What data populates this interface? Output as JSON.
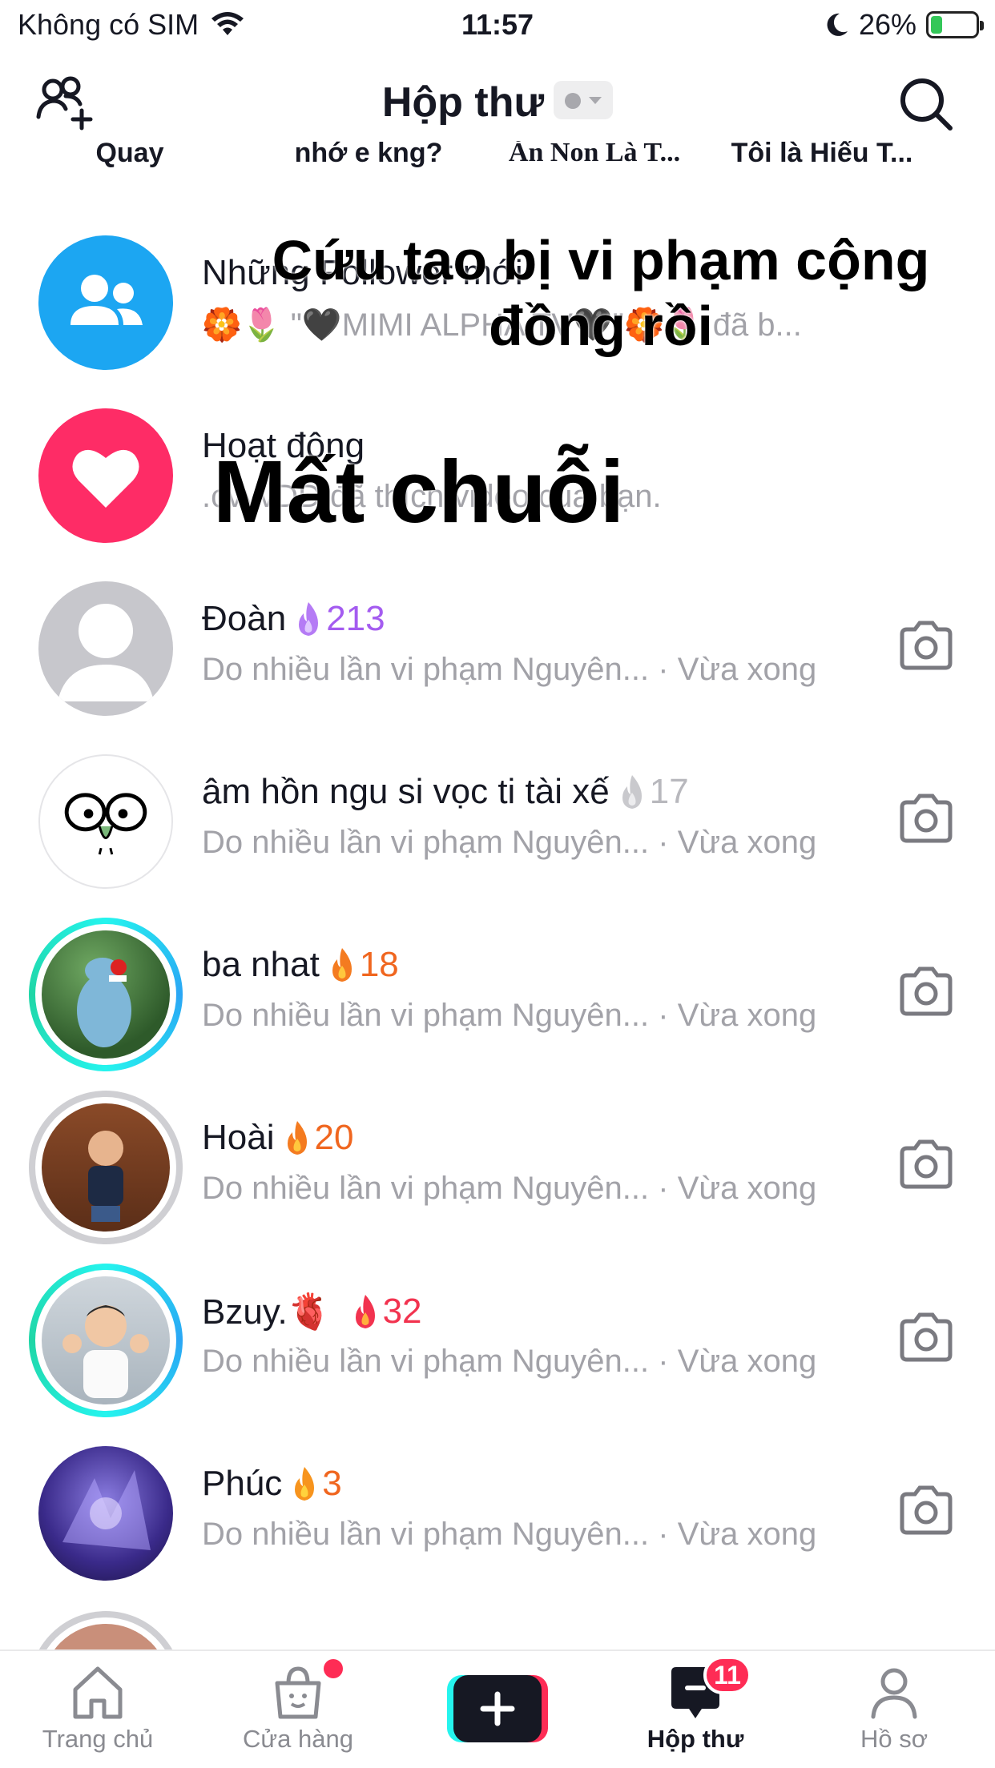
{
  "status_bar": {
    "carrier": "Không có SIM",
    "time": "11:57",
    "battery_percent": "26%",
    "battery_level": 0.26
  },
  "header": {
    "title": "Hộp thư",
    "icons": [
      "add-friend-icon",
      "search-icon"
    ]
  },
  "stories": [
    "Quay",
    "nhớ e kng?",
    "Ăn Non Là T...",
    "Tôi là Hiếu T..."
  ],
  "system_rows": [
    {
      "title": "Những Follower mới",
      "subtitle": "🏵️🌷 \"🖤MIMI ALPHA TV🖤\"🏵️🌷 đã b...",
      "icon": "followers-icon",
      "color": "#1ca6f2"
    },
    {
      "title": "Hoạt động",
      "subtitle": ".cvvvDD đã thích video của bạn.",
      "icon": "heart-icon",
      "color": "#fe2c66"
    }
  ],
  "captions": {
    "top": "Cứu tao bị vi phạm cộng đồng rồi",
    "middle": "Mất chuỗi"
  },
  "chats": [
    {
      "name": "Đoàn",
      "streak": "213",
      "streak_color": "#a45cf0",
      "message": "Do nhiều lần vi phạm Nguyên...",
      "time": "Vừa xong"
    },
    {
      "name": "âm hồn ngu si vọc ti tài xế",
      "streak": "17",
      "streak_color": "#b8b8bd",
      "message": "Do nhiều lần vi phạm Nguyên...",
      "time": "Vừa xong"
    },
    {
      "name": "ba nhat",
      "streak": "18",
      "streak_color": "#f0661f",
      "message": "Do nhiều lần vi phạm Nguyên...",
      "time": "Vừa xong"
    },
    {
      "name": "Hoài",
      "streak": "20",
      "streak_color": "#f0661f",
      "message": "Do nhiều lần vi phạm Nguyên...",
      "time": "Vừa xong"
    },
    {
      "name": "Bzuy.🫀",
      "streak": "32",
      "streak_color": "#f2334f",
      "message": "Do nhiều lần vi phạm Nguyên...",
      "time": "Vừa xong"
    },
    {
      "name": "Phúc",
      "streak": "3",
      "streak_color": "#f0661f",
      "message": "Do nhiều lần vi phạm Nguyên...",
      "time": "Vừa xong"
    }
  ],
  "separator": "·",
  "tabbar": {
    "home": "Trang chủ",
    "shop": "Cửa hàng",
    "inbox": "Hộp thư",
    "inbox_badge": "11",
    "profile": "Hồ sơ"
  },
  "colors": {
    "accent_red": "#fe2c55",
    "cyan": "#25f4ee",
    "text_secondary": "#a2a2a8"
  }
}
